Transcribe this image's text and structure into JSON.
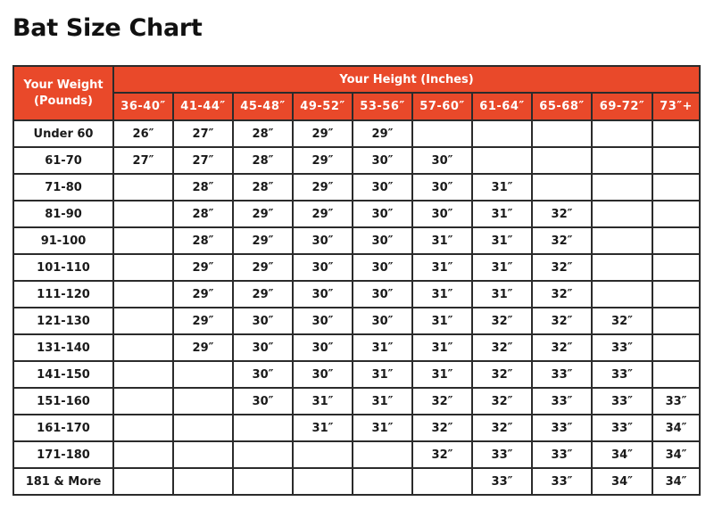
{
  "title": "Bat Size Chart",
  "header": {
    "weight_label_line1": "Your Weight",
    "weight_label_line2": "(Pounds)",
    "height_label": "Your Height (Inches)",
    "height_columns": [
      "36-40″",
      "41-44″",
      "45-48″",
      "49-52″",
      "53-56″",
      "57-60″",
      "61-64″",
      "65-68″",
      "69-72″",
      "73″+"
    ]
  },
  "colors": {
    "header_bg": "#e9492a",
    "header_text": "#ffffff",
    "grid": "#2b2b2b"
  },
  "rows": [
    {
      "weight": "Under 60",
      "cells": [
        "26″",
        "27″",
        "28″",
        "29″",
        "29″",
        "",
        "",
        "",
        "",
        ""
      ]
    },
    {
      "weight": "61-70",
      "cells": [
        "27″",
        "27″",
        "28″",
        "29″",
        "30″",
        "30″",
        "",
        "",
        "",
        ""
      ]
    },
    {
      "weight": "71-80",
      "cells": [
        "",
        "28″",
        "28″",
        "29″",
        "30″",
        "30″",
        "31″",
        "",
        "",
        ""
      ]
    },
    {
      "weight": "81-90",
      "cells": [
        "",
        "28″",
        "29″",
        "29″",
        "30″",
        "30″",
        "31″",
        "32″",
        "",
        ""
      ]
    },
    {
      "weight": "91-100",
      "cells": [
        "",
        "28″",
        "29″",
        "30″",
        "30″",
        "31″",
        "31″",
        "32″",
        "",
        ""
      ]
    },
    {
      "weight": "101-110",
      "cells": [
        "",
        "29″",
        "29″",
        "30″",
        "30″",
        "31″",
        "31″",
        "32″",
        "",
        ""
      ]
    },
    {
      "weight": "111-120",
      "cells": [
        "",
        "29″",
        "29″",
        "30″",
        "30″",
        "31″",
        "31″",
        "32″",
        "",
        ""
      ]
    },
    {
      "weight": "121-130",
      "cells": [
        "",
        "29″",
        "30″",
        "30″",
        "30″",
        "31″",
        "32″",
        "32″",
        "32″",
        ""
      ]
    },
    {
      "weight": "131-140",
      "cells": [
        "",
        "29″",
        "30″",
        "30″",
        "31″",
        "31″",
        "32″",
        "32″",
        "33″",
        ""
      ]
    },
    {
      "weight": "141-150",
      "cells": [
        "",
        "",
        "30″",
        "30″",
        "31″",
        "31″",
        "32″",
        "33″",
        "33″",
        ""
      ]
    },
    {
      "weight": "151-160",
      "cells": [
        "",
        "",
        "30″",
        "31″",
        "31″",
        "32″",
        "32″",
        "33″",
        "33″",
        "33″"
      ]
    },
    {
      "weight": "161-170",
      "cells": [
        "",
        "",
        "",
        "31″",
        "31″",
        "32″",
        "32″",
        "33″",
        "33″",
        "34″"
      ]
    },
    {
      "weight": "171-180",
      "cells": [
        "",
        "",
        "",
        "",
        "",
        "32″",
        "33″",
        "33″",
        "34″",
        "34″"
      ]
    },
    {
      "weight": "181 & More",
      "cells": [
        "",
        "",
        "",
        "",
        "",
        "",
        "33″",
        "33″",
        "34″",
        "34″"
      ]
    }
  ]
}
